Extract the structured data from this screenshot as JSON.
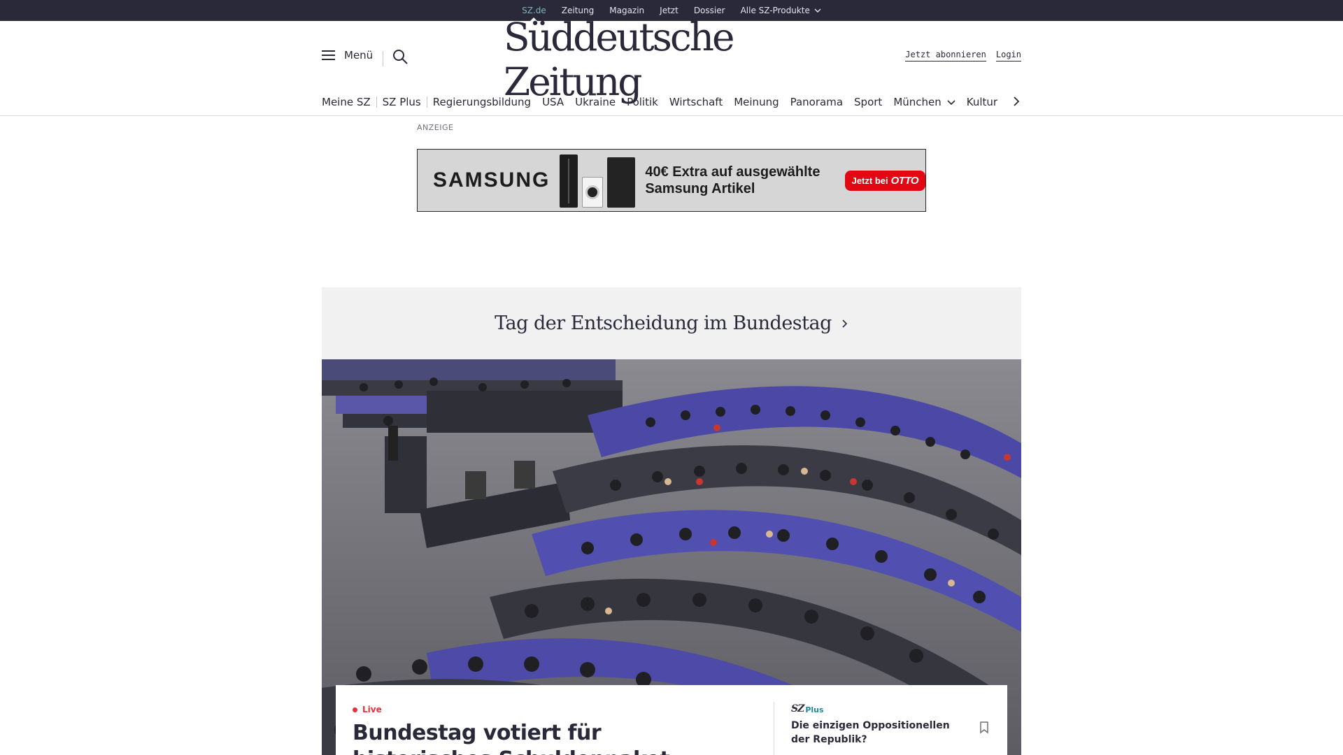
{
  "topbar": {
    "items": [
      {
        "label": "SZ.de",
        "active": true
      },
      {
        "label": "Zeitung"
      },
      {
        "label": "Magazin"
      },
      {
        "label": "Jetzt"
      },
      {
        "label": "Dossier"
      },
      {
        "label": "Alle SZ-Produkte",
        "has_dropdown": true
      }
    ],
    "active_color": "#7fb2b9",
    "background": "#29293a"
  },
  "header": {
    "menu_label": "Menü",
    "menu_icon": "hamburger-icon",
    "search_icon": "search-icon",
    "logo_text": "Süddeutsche Zeitung",
    "subscribe_label": "Jetzt abonnieren",
    "login_label": "Login"
  },
  "nav": {
    "items": [
      {
        "label": "Meine SZ"
      },
      {
        "label": "SZ Plus"
      },
      {
        "label": "Regierungsbildung"
      },
      {
        "label": "USA"
      },
      {
        "label": "Ukraine"
      },
      {
        "label": "Politik"
      },
      {
        "label": "Wirtschaft"
      },
      {
        "label": "Meinung"
      },
      {
        "label": "Panorama"
      },
      {
        "label": "Sport"
      },
      {
        "label": "München",
        "has_dropdown": true
      },
      {
        "label": "Kultur"
      }
    ],
    "more_icon": "chevron-right-icon"
  },
  "ad": {
    "label": "ANZEIGE",
    "brand": "SAMSUNG",
    "text": "40€ Extra auf ausgewählte Samsung Artikel",
    "cta_prefix": "Jetzt bei",
    "cta_brand": "OTTO",
    "cta_color": "#e30613"
  },
  "topic": {
    "title": "Tag der Entscheidung im Bundestag",
    "icon": "chevron-right-icon"
  },
  "hero": {
    "image": "bundestag-plenary-photo"
  },
  "article": {
    "live_label": "Live",
    "headline": "Bundestag votiert für historisches Schuldenpaket",
    "live_color": "#e3313e"
  },
  "side_article": {
    "badge_sz": "SZ",
    "badge_plus": "Plus",
    "title": "Die einzigen Oppositionellen der Republik?",
    "bookmark_icon": "bookmark-icon",
    "plus_color": "#1d8a9a"
  }
}
